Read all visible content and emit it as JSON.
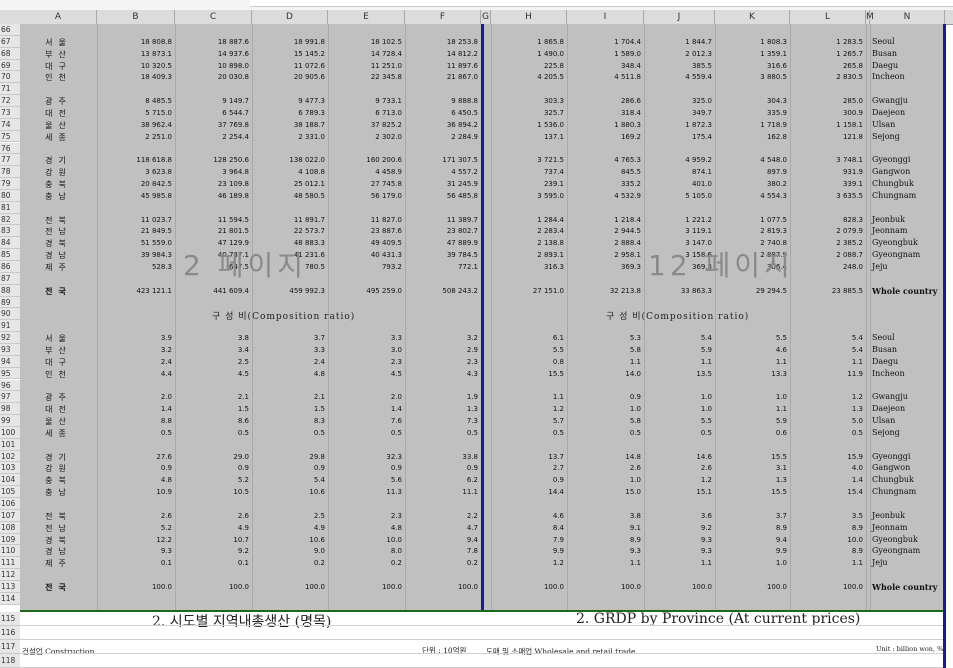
{
  "columns": [
    "A",
    "B",
    "C",
    "D",
    "E",
    "F",
    "G",
    "H",
    "I",
    "J",
    "K",
    "L",
    "M",
    "N"
  ],
  "rows_top": [
    {
      "n": "66",
      "ko": "",
      "en": "",
      "v": []
    },
    {
      "n": "67",
      "ko": "서울",
      "en": "Seoul",
      "v": [
        "18 808.8",
        "18 887.6",
        "18 991.8",
        "18 102.5",
        "18 253.8",
        "1 865.8",
        "1 704.4",
        "1 844.7",
        "1 808.3",
        "1 283.5"
      ]
    },
    {
      "n": "68",
      "ko": "부산",
      "en": "Busan",
      "v": [
        "13 873.1",
        "14 937.6",
        "15 145.2",
        "14 728.4",
        "14 812.2",
        "1 490.0",
        "1 589.0",
        "2 012.3",
        "1 359.1",
        "1 265.7"
      ]
    },
    {
      "n": "69",
      "ko": "대구",
      "en": "Daegu",
      "v": [
        "10 320.5",
        "10 898.0",
        "11 072.6",
        "11 251.0",
        "11 897.6",
        "225.8",
        "348.4",
        "385.5",
        "316.6",
        "265.8"
      ]
    },
    {
      "n": "70",
      "ko": "인천",
      "en": "Incheon",
      "v": [
        "18 409.3",
        "20 030.8",
        "20 905.6",
        "22 345.8",
        "21 867.0",
        "4 205.5",
        "4 511.8",
        "4 559.4",
        "3 880.5",
        "2 830.5"
      ]
    },
    {
      "n": "71",
      "ko": "",
      "en": "",
      "v": []
    },
    {
      "n": "72",
      "ko": "광주",
      "en": "Gwangju",
      "v": [
        "8 485.5",
        "9 149.7",
        "9 477.3",
        "9 733.1",
        "9 888.8",
        "303.3",
        "286.6",
        "325.0",
        "304.3",
        "285.0"
      ]
    },
    {
      "n": "73",
      "ko": "대전",
      "en": "Daejeon",
      "v": [
        "5 715.0",
        "6 544.7",
        "6 789.3",
        "6 713.0",
        "6 450.5",
        "325.7",
        "318.4",
        "349.7",
        "335.9",
        "300.9"
      ]
    },
    {
      "n": "74",
      "ko": "울산",
      "en": "Ulsan",
      "v": [
        "38 962.4",
        "37 769.8",
        "38 188.7",
        "37 825.2",
        "36 894.2",
        "1 536.0",
        "1 880.3",
        "1 872.3",
        "1 718.9",
        "1 158.1"
      ]
    },
    {
      "n": "75",
      "ko": "세종",
      "en": "Sejong",
      "v": [
        "2 251.0",
        "2 254.4",
        "2 331.0",
        "2 302.0",
        "2 284.9",
        "137.1",
        "169.2",
        "175.4",
        "162.8",
        "121.8"
      ]
    },
    {
      "n": "76",
      "ko": "",
      "en": "",
      "v": []
    },
    {
      "n": "77",
      "ko": "경기",
      "en": "Gyeonggi",
      "v": [
        "118 618.8",
        "128 250.6",
        "138 022.0",
        "160 200.6",
        "171 307.5",
        "3 721.5",
        "4 765.3",
        "4 959.2",
        "4 548.0",
        "3 748.1"
      ]
    },
    {
      "n": "78",
      "ko": "강원",
      "en": "Gangwon",
      "v": [
        "3 623.8",
        "3 964.8",
        "4 108.8",
        "4 458.9",
        "4 557.2",
        "737.4",
        "845.5",
        "874.1",
        "897.9",
        "931.9"
      ]
    },
    {
      "n": "79",
      "ko": "충북",
      "en": "Chungbuk",
      "v": [
        "20 842.5",
        "23 109.8",
        "25 012.1",
        "27 745.8",
        "31 245.9",
        "239.1",
        "335.2",
        "401.0",
        "380.2",
        "339.1"
      ]
    },
    {
      "n": "80",
      "ko": "충남",
      "en": "Chungnam",
      "v": [
        "45 985.8",
        "46 189.8",
        "48 580.5",
        "56 179.0",
        "56 485.8",
        "3 595.0",
        "4 532.9",
        "5 105.0",
        "4 554.3",
        "3 635.5"
      ]
    },
    {
      "n": "81",
      "ko": "",
      "en": "",
      "v": []
    },
    {
      "n": "82",
      "ko": "전북",
      "en": "Jeonbuk",
      "v": [
        "11 023.7",
        "11 594.5",
        "11 891.7",
        "11 827.0",
        "11 389.7",
        "1 284.4",
        "1 218.4",
        "1 221.2",
        "1 077.5",
        "828.3"
      ]
    },
    {
      "n": "83",
      "ko": "전남",
      "en": "Jeonnam",
      "v": [
        "21 849.5",
        "21 801.5",
        "22 573.7",
        "23 887.6",
        "23 802.7",
        "2 283.4",
        "2 944.5",
        "3 119.1",
        "2 819.3",
        "2 079.9"
      ]
    },
    {
      "n": "84",
      "ko": "경북",
      "en": "Gyeongbuk",
      "v": [
        "51 559.0",
        "47 129.9",
        "48 883.3",
        "49 409.5",
        "47 889.9",
        "2 138.8",
        "2 888.4",
        "3 147.0",
        "2 740.8",
        "2 385.2"
      ]
    },
    {
      "n": "85",
      "ko": "경남",
      "en": "Gyeongnam",
      "v": [
        "39 984.3",
        "40 737.1",
        "41 231.6",
        "40 431.3",
        "39 784.5",
        "2 893.1",
        "2 958.1",
        "3 158.6",
        "2 887.9",
        "2 088.7"
      ]
    },
    {
      "n": "86",
      "ko": "제주",
      "en": "Jeju",
      "v": [
        "528.3",
        "647.5",
        "780.5",
        "793.2",
        "772.1",
        "316.3",
        "369.3",
        "369.3",
        "306.4",
        "248.0"
      ]
    },
    {
      "n": "87",
      "ko": "",
      "en": "",
      "v": []
    },
    {
      "n": "88",
      "ko": "전국",
      "en": "Whole country",
      "bold": true,
      "v": [
        "423 121.1",
        "441 609.4",
        "459 992.3",
        "495 259.0",
        "508 243.2",
        "27 151.0",
        "32 213.8",
        "33 863.3",
        "29 294.5",
        "23 885.5"
      ]
    },
    {
      "n": "89",
      "ko": "",
      "en": "",
      "v": []
    }
  ],
  "composition_label": "구 성 비(Composition ratio)",
  "rows_bottom": [
    {
      "n": "91",
      "ko": "",
      "en": "",
      "v": []
    },
    {
      "n": "92",
      "ko": "서울",
      "en": "Seoul",
      "v": [
        "3.9",
        "3.8",
        "3.7",
        "3.3",
        "3.2",
        "6.1",
        "5.3",
        "5.4",
        "5.5",
        "5.4"
      ]
    },
    {
      "n": "93",
      "ko": "부산",
      "en": "Busan",
      "v": [
        "3.2",
        "3.4",
        "3.3",
        "3.0",
        "2.9",
        "5.5",
        "5.8",
        "5.9",
        "4.6",
        "5.4"
      ]
    },
    {
      "n": "94",
      "ko": "대구",
      "en": "Daegu",
      "v": [
        "2.4",
        "2.5",
        "2.4",
        "2.3",
        "2.3",
        "0.8",
        "1.1",
        "1.1",
        "1.1",
        "1.1"
      ]
    },
    {
      "n": "95",
      "ko": "인천",
      "en": "Incheon",
      "v": [
        "4.4",
        "4.5",
        "4.8",
        "4.5",
        "4.3",
        "15.5",
        "14.0",
        "13.5",
        "13.3",
        "11.9"
      ]
    },
    {
      "n": "96",
      "ko": "",
      "en": "",
      "v": []
    },
    {
      "n": "97",
      "ko": "광주",
      "en": "Gwangju",
      "v": [
        "2.0",
        "2.1",
        "2.1",
        "2.0",
        "1.9",
        "1.1",
        "0.9",
        "1.0",
        "1.0",
        "1.2"
      ]
    },
    {
      "n": "98",
      "ko": "대전",
      "en": "Daejeon",
      "v": [
        "1.4",
        "1.5",
        "1.5",
        "1.4",
        "1.3",
        "1.2",
        "1.0",
        "1.0",
        "1.1",
        "1.3"
      ]
    },
    {
      "n": "99",
      "ko": "울산",
      "en": "Ulsan",
      "v": [
        "8.8",
        "8.6",
        "8.3",
        "7.6",
        "7.3",
        "5.7",
        "5.8",
        "5.5",
        "5.9",
        "5.0"
      ]
    },
    {
      "n": "100",
      "ko": "세종",
      "en": "Sejong",
      "v": [
        "0.5",
        "0.5",
        "0.5",
        "0.5",
        "0.5",
        "0.5",
        "0.5",
        "0.5",
        "0.6",
        "0.5"
      ]
    },
    {
      "n": "101",
      "ko": "",
      "en": "",
      "v": []
    },
    {
      "n": "102",
      "ko": "경기",
      "en": "Gyeonggi",
      "v": [
        "27.6",
        "29.0",
        "29.8",
        "32.3",
        "33.8",
        "13.7",
        "14.8",
        "14.6",
        "15.5",
        "15.9"
      ]
    },
    {
      "n": "103",
      "ko": "강원",
      "en": "Gangwon",
      "v": [
        "0.9",
        "0.9",
        "0.9",
        "0.9",
        "0.9",
        "2.7",
        "2.6",
        "2.6",
        "3.1",
        "4.0"
      ]
    },
    {
      "n": "104",
      "ko": "충북",
      "en": "Chungbuk",
      "v": [
        "4.8",
        "5.2",
        "5.4",
        "5.6",
        "6.2",
        "0.9",
        "1.0",
        "1.2",
        "1.3",
        "1.4"
      ]
    },
    {
      "n": "105",
      "ko": "충남",
      "en": "Chungnam",
      "v": [
        "10.9",
        "10.5",
        "10.6",
        "11.3",
        "11.1",
        "14.4",
        "15.0",
        "15.1",
        "15.5",
        "15.4"
      ]
    },
    {
      "n": "106",
      "ko": "",
      "en": "",
      "v": []
    },
    {
      "n": "107",
      "ko": "전북",
      "en": "Jeonbuk",
      "v": [
        "2.6",
        "2.6",
        "2.5",
        "2.3",
        "2.2",
        "4.6",
        "3.8",
        "3.6",
        "3.7",
        "3.5"
      ]
    },
    {
      "n": "108",
      "ko": "전남",
      "en": "Jeonnam",
      "v": [
        "5.2",
        "4.9",
        "4.9",
        "4.8",
        "4.7",
        "8.4",
        "9.1",
        "9.2",
        "8.9",
        "8.9"
      ]
    },
    {
      "n": "109",
      "ko": "경북",
      "en": "Gyeongbuk",
      "v": [
        "12.2",
        "10.7",
        "10.6",
        "10.0",
        "9.4",
        "7.9",
        "8.9",
        "9.3",
        "9.4",
        "10.0"
      ]
    },
    {
      "n": "110",
      "ko": "경남",
      "en": "Gyeongnam",
      "v": [
        "9.3",
        "9.2",
        "9.0",
        "8.0",
        "7.8",
        "9.9",
        "9.3",
        "9.3",
        "9.9",
        "8.9"
      ]
    },
    {
      "n": "111",
      "ko": "제주",
      "en": "Jeju",
      "v": [
        "0.1",
        "0.1",
        "0.2",
        "0.2",
        "0.2",
        "1.2",
        "1.1",
        "1.1",
        "1.0",
        "1.1"
      ]
    },
    {
      "n": "112",
      "ko": "",
      "en": "",
      "v": []
    },
    {
      "n": "113",
      "ko": "전국",
      "en": "Whole country",
      "bold": true,
      "v": [
        "100.0",
        "100.0",
        "100.0",
        "100.0",
        "100.0",
        "100.0",
        "100.0",
        "100.0",
        "100.0",
        "100.0"
      ]
    },
    {
      "n": "114",
      "ko": "",
      "en": "",
      "v": []
    }
  ],
  "row90": "90",
  "watermarks": [
    "2 페이지",
    "12 페이지"
  ],
  "bottom": {
    "rows": [
      "115",
      "116",
      "117",
      "118"
    ],
    "title_ko": "2. 시도별 지역내총생산 (명목)",
    "title_en": "2. GRDP by Province (At current prices)",
    "construction": "건설업 Construction",
    "unit_ko": "단위 : 10억원",
    "wholesale": "도매 및 소매업  Wholesale and retail trade",
    "unit_en": "Unit : billion won, %"
  }
}
